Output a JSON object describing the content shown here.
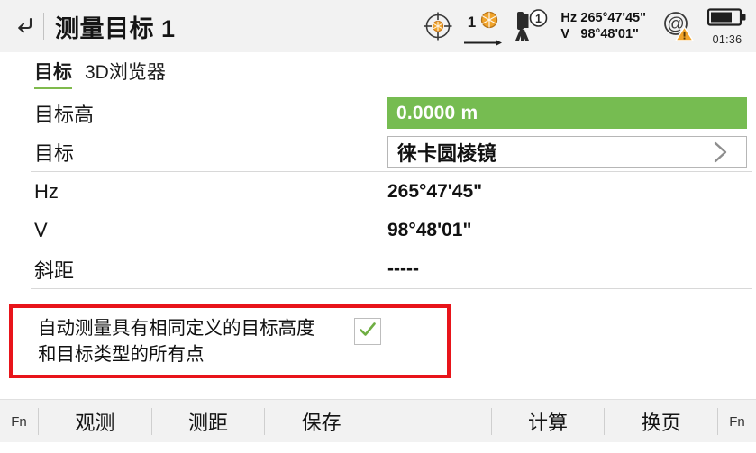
{
  "header": {
    "back_icon": "back-arrow-icon",
    "title": "测量目标 1",
    "status": {
      "target_icon": "crosshair-target-icon",
      "prism_count": "1",
      "prism_icon": "prism-icon",
      "arrow_icon": "arrow-right-icon",
      "instrument_icon": "total-station-icon",
      "instrument_badge": "1",
      "hz_label": "Hz",
      "hz_value": "265°47'45\"",
      "v_label": "V",
      "v_value": "98°48'01\"",
      "at_icon": "at-symbol-icon",
      "warning_icon": "warning-triangle-icon",
      "battery_icon": "battery-icon",
      "battery_level_percent": 68,
      "battery_time": "01:36"
    }
  },
  "tabs": [
    {
      "label": "目标",
      "active": true
    },
    {
      "label": "3D浏览器",
      "active": false
    }
  ],
  "form": {
    "rows": [
      {
        "label": "目标高",
        "value": "0.0000 m",
        "style": "green"
      },
      {
        "label": "目标",
        "value": "徕卡圆棱镜",
        "style": "box",
        "chevron": "chevron-right-icon"
      },
      {
        "label": "Hz",
        "value": "265°47'45\"",
        "style": "plain"
      },
      {
        "label": "V",
        "value": "98°48'01\"",
        "style": "plain"
      },
      {
        "label": "斜距",
        "value": "-----",
        "style": "plain"
      }
    ]
  },
  "auto_measure": {
    "label_line1": "自动测量具有相同定义的目标高度",
    "label_line2": "和目标类型的所有点",
    "checked": true,
    "check_icon": "checkmark-icon",
    "annotation_color": "#e8141a"
  },
  "toolbar": {
    "fn_left": "Fn",
    "buttons": [
      {
        "label": "观测"
      },
      {
        "label": "测距"
      },
      {
        "label": "保存"
      },
      {
        "label": ""
      },
      {
        "label": "计算"
      },
      {
        "label": "换页"
      }
    ],
    "fn_right": "Fn"
  },
  "colors": {
    "accent_green": "#76bc51",
    "tab_underline": "#7fba4c",
    "annotation_red": "#e8141a",
    "header_bg": "#f2f2f2",
    "orange": "#f0a32a"
  }
}
